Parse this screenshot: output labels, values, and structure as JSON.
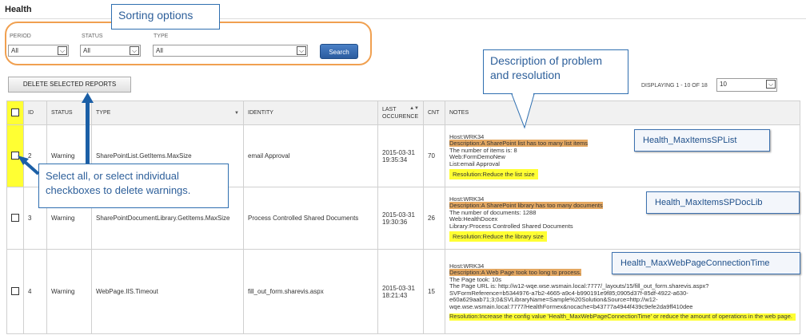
{
  "page": {
    "title": "Health"
  },
  "filters": {
    "period": {
      "label": "PERIOD",
      "value": "All"
    },
    "status": {
      "label": "STATUS",
      "value": "All"
    },
    "type": {
      "label": "TYPE",
      "value": "All"
    },
    "search_label": "Search"
  },
  "toolbar": {
    "delete_label": "DELETE SELECTED REPORTS",
    "displaying": "DISPLAYING 1 - 10 OF 18",
    "page_size": "10"
  },
  "table": {
    "headers": [
      "",
      "ID",
      "STATUS",
      "TYPE",
      "IDENTITY",
      "LAST OCCURENCE",
      "CNT",
      "NOTES"
    ],
    "rows": [
      {
        "id": "2",
        "status": "Warning",
        "type": "SharePointList.GetItems.MaxSize",
        "identity": "email Approval",
        "last": "2015-03-31 19:35:34",
        "cnt": "70",
        "notes": {
          "host": "Host:WRK34",
          "desc": "Description:A SharePoint list has too many list items",
          "extra": [
            "The number of items is: 8",
            "Web:FormDemoNew",
            "List:email Approval"
          ],
          "resolution": "Resolution:Reduce the list size"
        }
      },
      {
        "id": "3",
        "status": "Warning",
        "type": "SharePointDocumentLibrary.GetItems.MaxSize",
        "identity": "Process Controlled Shared Documents",
        "last": "2015-03-31 19:30:36",
        "cnt": "26",
        "notes": {
          "host": "Host:WRK34",
          "desc": "Description:A SharePoint library has too many documents",
          "extra": [
            "The number of documents: 1288",
            "Web:HealthDocex",
            "Library:Process Controlled Shared Documents"
          ],
          "resolution": "Resolution:Reduce the library size"
        }
      },
      {
        "id": "4",
        "status": "Warning",
        "type": "WebPage.IIS.Timeout",
        "identity": "fill_out_form.sharevis.aspx",
        "last": "2015-03-31 18:21:43",
        "cnt": "15",
        "notes": {
          "host": "Host:WRK34",
          "desc": "Description:A Web Page took too long to process.",
          "extra": [
            "The Page took: 10s",
            "The Page URL is: http://w12-wqe.wse.wsmain.local:7777/_layouts/15/fill_out_form.sharevis.aspx?",
            "SVFormReference=b5344976-a7b2-4665-a9c4-b990191e9f85;0905d37f-85df-4922-a630-",
            "e60a629aab71;3;0&SVLibraryName=Sample%20Solution&Source=http://w12-",
            "wqe.wse.wsmain.local:7777/HealthFormex&nocache=b43777a4944f439c9efe2da9ff410dee"
          ],
          "resolution": "Resolution:Increase the config value 'Health_MaxWebPageConnectionTime' or reduce the amount of operations in the web page."
        }
      }
    ]
  },
  "annotations": {
    "sorting": "Sorting options",
    "description": "Description of problem and resolution",
    "select_all": "Select all, or select individual checkboxes to delete warnings.",
    "tag1": "Health_MaxItemsSPList",
    "tag2": "Health_MaxItemsSPDocLib",
    "tag3": "Health_MaxWebPageConnectionTime"
  },
  "colors": {
    "accent": "#2b5c9f",
    "highlight": "#ffff33",
    "sortbox": "#f0a050",
    "desc_highlight": "#e4a862"
  }
}
